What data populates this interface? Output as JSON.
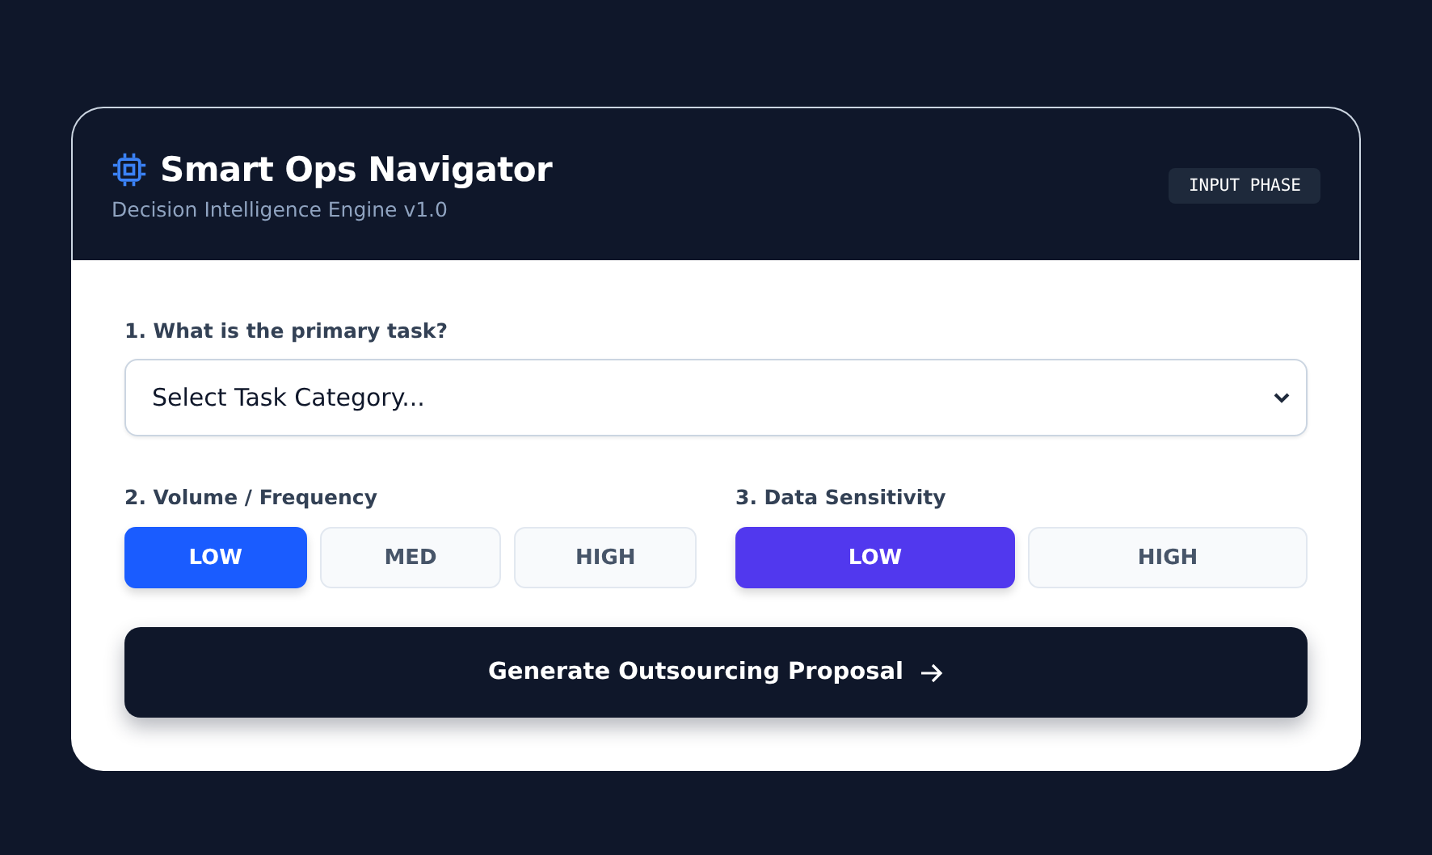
{
  "header": {
    "title": "Smart Ops Navigator",
    "subtitle": "Decision Intelligence Engine v1.0",
    "badge": "INPUT PHASE"
  },
  "task": {
    "label": "1. What is the primary task?",
    "value": "Select Task Category..."
  },
  "groups": [
    {
      "label": "2. Volume / Frequency",
      "color": "#1a5cff",
      "options": [
        {
          "label": "LOW",
          "selected": true
        },
        {
          "label": "MED",
          "selected": false
        },
        {
          "label": "HIGH",
          "selected": false
        }
      ]
    },
    {
      "label": "3. Data Sensitivity",
      "color": "#5138ee",
      "options": [
        {
          "label": "LOW",
          "selected": true
        },
        {
          "label": "HIGH",
          "selected": false
        }
      ]
    }
  ],
  "submit": {
    "label": "Generate Outsourcing Proposal"
  }
}
